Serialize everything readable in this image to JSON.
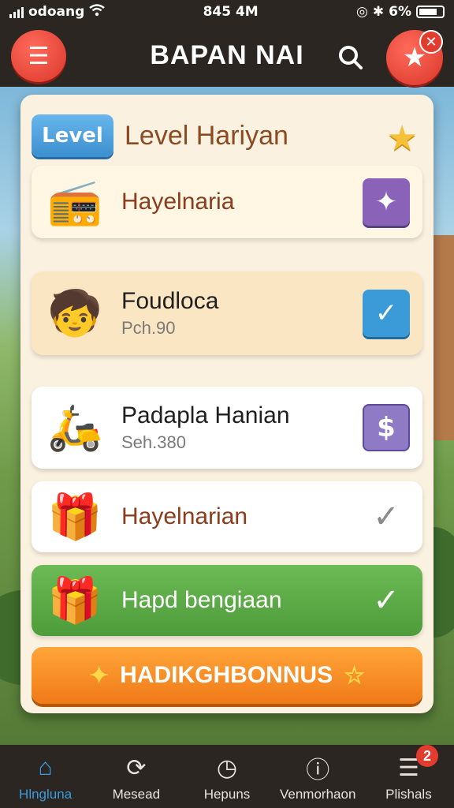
{
  "status_bar": {
    "carrier": "odoang",
    "time": "845 4M",
    "battery": "6%"
  },
  "header": {
    "title": "BAPAN NAI",
    "menu_icon": "menu-icon",
    "search_icon": "search-icon",
    "star_icon": "star-icon",
    "close_icon": "close-icon"
  },
  "panel": {
    "level_badge": "Level",
    "title": "Level Hariyan",
    "rows": [
      {
        "title": "Hayelnaria",
        "subtitle": "",
        "thumb_icon": "radio-house-icon",
        "action_icon": "wand-icon"
      },
      {
        "title": "Foudloca",
        "subtitle": "Pch.90",
        "thumb_icon": "character-icon",
        "action_icon": "check-icon"
      },
      {
        "title": "Padapla Hanian",
        "subtitle": "Seh.380",
        "thumb_icon": "scooter-icon",
        "action_icon": "dollar-icon"
      },
      {
        "title": "Hayelnarian",
        "subtitle": "",
        "thumb_icon": "gift-icon",
        "action_icon": "check-icon"
      },
      {
        "title": "Hapd bengiaan",
        "subtitle": "",
        "thumb_icon": "gift-coin-icon",
        "action_icon": "check-icon"
      }
    ],
    "bonus_button": "HADIKGHBONNUS"
  },
  "bottom_nav": [
    {
      "label": "Hlngluna",
      "icon": "home-icon",
      "active": true
    },
    {
      "label": "Mesead",
      "icon": "refresh-icon",
      "active": false
    },
    {
      "label": "Hepuns",
      "icon": "clock-icon",
      "active": false
    },
    {
      "label": "Venmorhaon",
      "icon": "alert-icon",
      "active": false
    },
    {
      "label": "Plishals",
      "icon": "list-icon",
      "active": false,
      "badge": "2"
    }
  ],
  "colors": {
    "accent_red": "#d9362a",
    "accent_blue": "#3a9bd8",
    "accent_green": "#4d9b3a",
    "accent_orange": "#f07a18",
    "panel_bg": "#fbf1e0"
  }
}
